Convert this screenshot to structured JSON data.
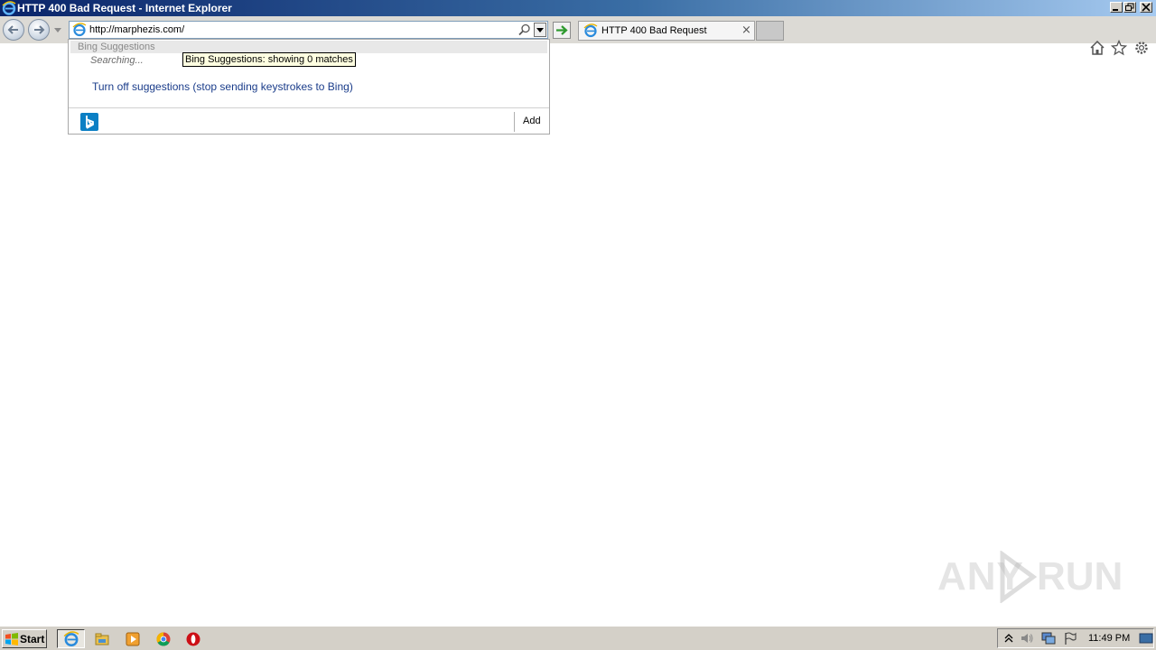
{
  "window": {
    "title": "HTTP 400 Bad Request - Internet Explorer"
  },
  "address_bar": {
    "url": "http://marphezis.com/"
  },
  "tab": {
    "label": "HTTP 400 Bad Request",
    "close": "×"
  },
  "suggestions": {
    "header": "Bing Suggestions",
    "status": "Searching...",
    "tooltip": "Bing Suggestions: showing 0 matches",
    "turn_off": "Turn off suggestions (stop sending keystrokes to Bing)",
    "add_label": "Add"
  },
  "watermark": {
    "left": "ANY",
    "right": "RUN"
  },
  "taskbar": {
    "start_label": "Start",
    "clock": "11:49 PM"
  },
  "colors": {
    "titlebar_start": "#0a246a",
    "titlebar_end": "#a6caf0",
    "link_blue": "#1a3c8a",
    "bing_blue": "#0b7fc4"
  }
}
